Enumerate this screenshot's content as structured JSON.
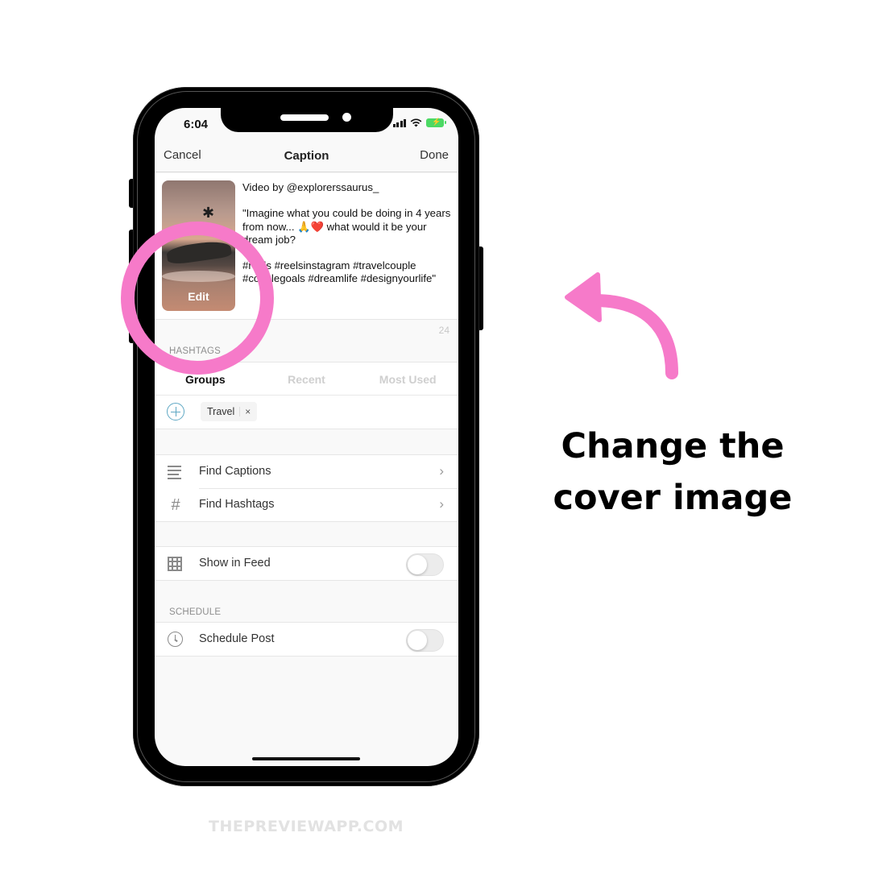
{
  "status_bar": {
    "time": "6:04"
  },
  "navbar": {
    "cancel": "Cancel",
    "title": "Caption",
    "done": "Done"
  },
  "caption": {
    "thumbnail_edit": "Edit",
    "text": "Video by @explorerssaurus_\n\n\"Imagine what you could be doing in 4 years from now... 🙏❤️ what would it be your dream job?\n\n#reels #reelsinstagram #travelcouple #couplegoals #dreamlife #designyourlife\"",
    "char_count": "24"
  },
  "hashtags": {
    "section_label": "HASHTAGS",
    "tabs": [
      {
        "label": "Groups",
        "active": true
      },
      {
        "label": "Recent",
        "active": false
      },
      {
        "label": "Most Used",
        "active": false
      }
    ],
    "chips": [
      {
        "label": "Travel",
        "remove": "×"
      }
    ]
  },
  "find_list": [
    {
      "label": "Find Captions",
      "icon": "lines-icon"
    },
    {
      "label": "Find Hashtags",
      "icon": "hash-icon"
    }
  ],
  "show_in_feed": {
    "label": "Show in Feed",
    "enabled": false
  },
  "schedule": {
    "section_label": "SCHEDULE",
    "label": "Schedule Post",
    "enabled": false
  },
  "annotation": {
    "line1": "Change the",
    "line2": "cover image",
    "accent_color": "#f67ac9"
  },
  "watermark": "THEPREVIEWAPP.COM"
}
